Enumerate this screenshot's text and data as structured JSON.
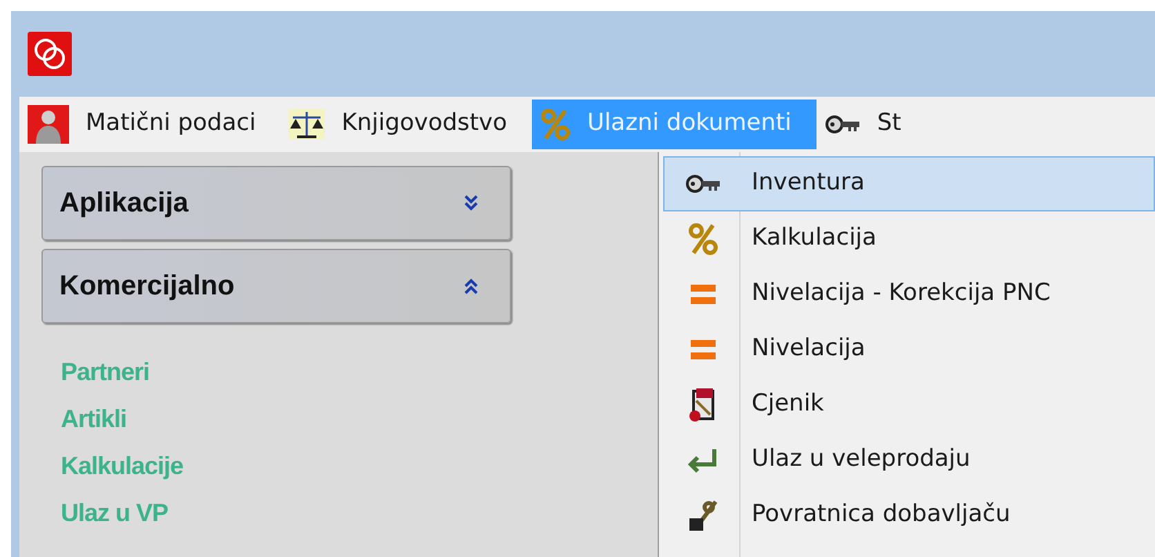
{
  "menu_bar": [
    {
      "label": "Matični podaci",
      "selected": false
    },
    {
      "label": "Knjigovodstvo",
      "selected": false
    },
    {
      "label": "Ulazni dokumenti",
      "selected": true
    },
    {
      "label": "St",
      "selected": false
    }
  ],
  "sidebar": {
    "sections": [
      {
        "title": "Aplikacija",
        "expanded": false
      },
      {
        "title": "Komercijalno",
        "expanded": true,
        "items": [
          "Partneri",
          "Artikli",
          "Kalkulacije",
          "Ulaz u VP"
        ]
      }
    ]
  },
  "dropdown": [
    {
      "label": "Inventura",
      "selected": true
    },
    {
      "label": "Kalkulacija",
      "selected": false
    },
    {
      "label": "Nivelacija - Korekcija PNC",
      "selected": false
    },
    {
      "label": "Nivelacija",
      "selected": false
    },
    {
      "label": "Cjenik",
      "selected": false
    },
    {
      "label": "Ulaz u veleprodaju",
      "selected": false
    },
    {
      "label": "Povratnica dobavljaču",
      "selected": false
    }
  ]
}
